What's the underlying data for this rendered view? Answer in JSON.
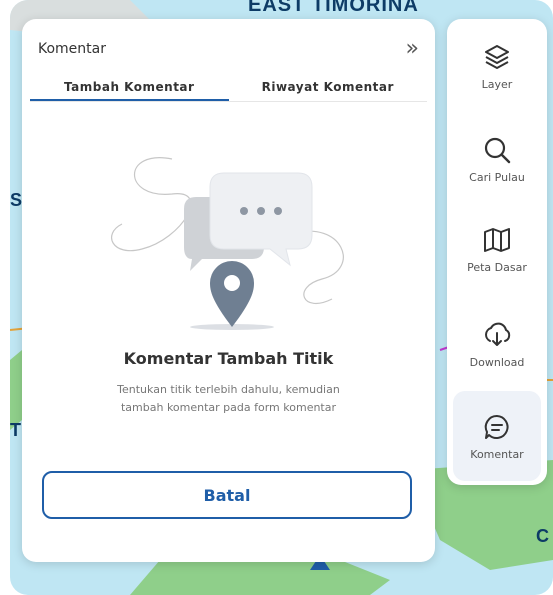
{
  "map": {
    "labels": [
      "EAST TIMORINA",
      "SI",
      "T",
      "C"
    ]
  },
  "panel": {
    "title": "Komentar",
    "collapse_icon": "double-chevron-right-icon",
    "tabs": [
      {
        "label": "Tambah Komentar",
        "active": true
      },
      {
        "label": "Riwayat Komentar",
        "active": false
      }
    ],
    "empty_title": "Komentar Tambah Titik",
    "empty_desc_line1": "Tentukan titik terlebih dahulu, kemudian",
    "empty_desc_line2": "tambah komentar pada form komentar",
    "cancel_label": "Batal"
  },
  "toolbar": {
    "items": [
      {
        "label": "Layer",
        "icon": "layers-icon",
        "active": false
      },
      {
        "label": "Cari Pulau",
        "icon": "search-icon",
        "active": false
      },
      {
        "label": "Peta Dasar",
        "icon": "map-icon",
        "active": false
      },
      {
        "label": "Download",
        "icon": "download-icon",
        "active": false
      },
      {
        "label": "Komentar",
        "icon": "comment-icon",
        "active": true
      }
    ]
  },
  "colors": {
    "accent": "#1f5ea8",
    "sea": "#bfe6f3",
    "land": "#8fcf8a"
  }
}
